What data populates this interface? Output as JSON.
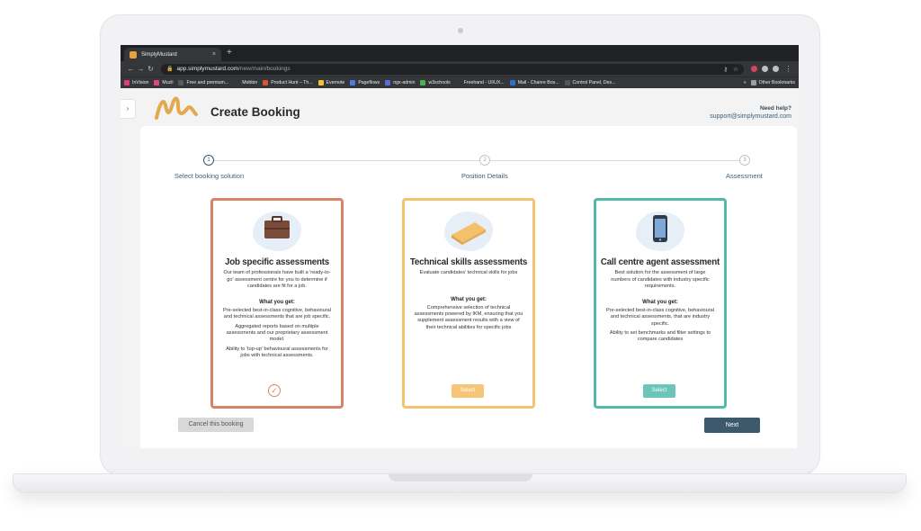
{
  "browser": {
    "tab_title": "SimplyMustard",
    "tab_close": "×",
    "new_tab": "+",
    "url_host": "app.simplymustard.com",
    "url_path": "/new/main/bookings",
    "bookmarks": [
      {
        "label": "InVision",
        "color": "#e23f78"
      },
      {
        "label": "Muzli",
        "color": "#e0457b"
      },
      {
        "label": "Free and premium...",
        "color": "#444444"
      },
      {
        "label": "Mobbin",
        "color": "#35363a"
      },
      {
        "label": "Product Hunt – Th...",
        "color": "#da552f"
      },
      {
        "label": "Evernote",
        "color": "#f2c230"
      },
      {
        "label": "Pageflows",
        "color": "#4c7ce0"
      },
      {
        "label": "ngx-admin",
        "color": "#5b6bd8"
      },
      {
        "label": "w3schools",
        "color": "#4caf50"
      },
      {
        "label": "Freehand - UI/UX...",
        "color": "#35363a"
      },
      {
        "label": "Mail - Chanre Bos...",
        "color": "#2f6fd1"
      },
      {
        "label": "Control Panel, Des...",
        "color": "#555555"
      }
    ],
    "other_bookmarks": "Other Bookmarks"
  },
  "header": {
    "title": "Create Booking",
    "help_question": "Need help?",
    "help_email": "support@simplymustard.com"
  },
  "stepper": {
    "steps": [
      {
        "number": "1",
        "label": "Select booking solution",
        "active": true
      },
      {
        "number": "2",
        "label": "Position Details",
        "active": false
      },
      {
        "number": "3",
        "label": "Assessment",
        "active": false
      }
    ]
  },
  "cards": [
    {
      "title": "Job specific assessments",
      "description": "Our team of professionals have built a 'ready-to-go' assessment centre for you to determine if candidates are fit for a job.",
      "what_title": "What you get:",
      "items": [
        "Pre-selected best-in-class cognitive, behavioural and technical assessments that are job specific.",
        "Aggregated reports based on multiple assessments and our proprietary assessment model.",
        "Ability to 'top-up' behavioural assessments for jobs with technical assessments."
      ],
      "selected": true,
      "accent": "#d9846a"
    },
    {
      "title": "Technical skills assessments",
      "description": "Evaluate candidates' technical skills for jobs",
      "what_title": "What you get:",
      "items": [
        "Comprehensive selection of technical assessments powered by IKM, ensuring that you supplement assessment results with a view of their technical abilities for specific jobs"
      ],
      "button": "Select",
      "accent": "#f4c36f"
    },
    {
      "title": "Call centre agent assessment",
      "description": "Best solution for the assessment of large numbers of candidates with industry specific requirements.",
      "what_title": "What you get:",
      "items": [
        "Pre-selected best-in-class cognitive, behavioural and technical assessments, that are industry specific.",
        "Ability to set benchmarks and filter settings to compare candidates"
      ],
      "button": "Select",
      "accent": "#53b9a9"
    }
  ],
  "footer": {
    "cancel": "Cancel this booking",
    "next": "Next"
  }
}
